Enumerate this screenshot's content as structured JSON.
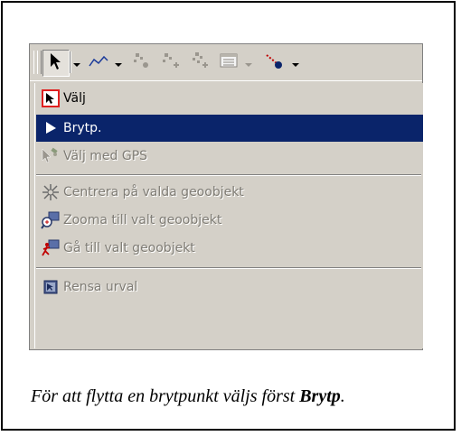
{
  "toolbar": {
    "buttons": [
      {
        "name": "select-arrow",
        "icon": "arrow-cursor-icon",
        "has_dropdown": true,
        "pressed": true
      },
      {
        "name": "polyline",
        "icon": "polyline-icon",
        "has_dropdown": true
      },
      {
        "name": "vertex-tool-1",
        "icon": "vertex-icon",
        "has_dropdown": false
      },
      {
        "name": "vertex-tool-2",
        "icon": "vertex-add-icon",
        "has_dropdown": false
      },
      {
        "name": "vertex-tool-3",
        "icon": "vertex-plus-icon",
        "has_dropdown": false
      },
      {
        "name": "attribute-table",
        "icon": "table-icon",
        "has_dropdown": true
      },
      {
        "name": "snap-tool",
        "icon": "snap-point-icon",
        "has_dropdown": true
      }
    ]
  },
  "menu": {
    "items": [
      {
        "label": "Välj",
        "icon": "select-arrow-icon",
        "state": "normal"
      },
      {
        "label": "Brytp.",
        "icon": "vertex-arrow-icon",
        "state": "selected"
      },
      {
        "label": "Välj med GPS",
        "icon": "gps-select-icon",
        "state": "disabled"
      },
      {
        "label": "Centrera på valda geoobjekt",
        "icon": "center-icon",
        "state": "disabled"
      },
      {
        "label": "Zooma till valt geoobjekt",
        "icon": "zoom-to-icon",
        "state": "disabled"
      },
      {
        "label": "Gå till valt geoobjekt",
        "icon": "goto-icon",
        "state": "disabled"
      },
      {
        "label": "Rensa urval",
        "icon": "clear-selection-icon",
        "state": "disabled"
      }
    ]
  },
  "caption": {
    "prefix": "För att flytta en brytpunkt väljs först ",
    "emphasis": "Brytp",
    "suffix": "."
  },
  "colors": {
    "menu_bg": "#d4d0c8",
    "selected_bg": "#0a246a",
    "disabled_text": "#7f7c75",
    "highlight_red": "#e02020"
  }
}
